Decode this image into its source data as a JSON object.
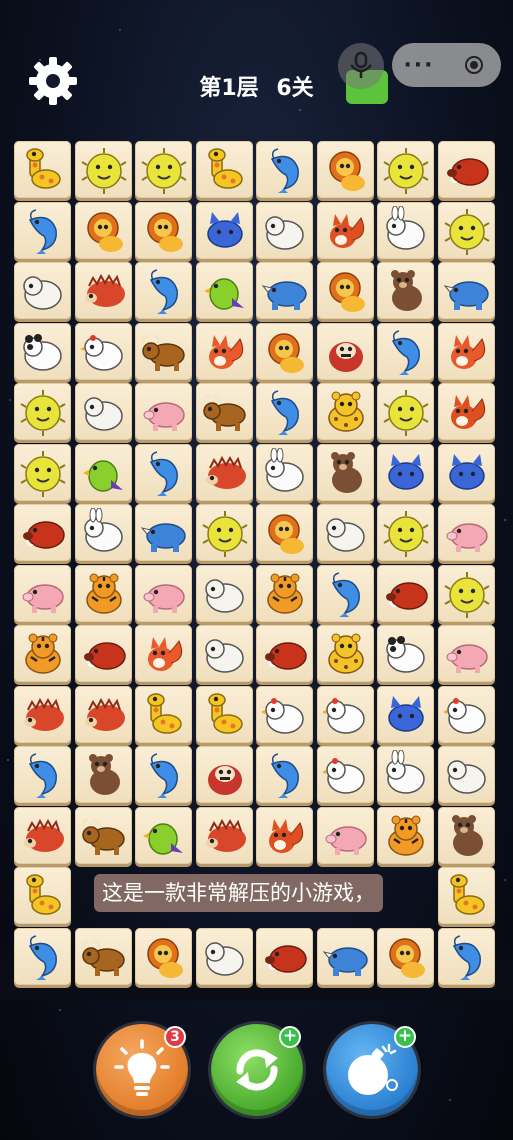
{
  "header": {
    "level": "第1层",
    "stage": "6关"
  },
  "capsule": {
    "more": "···"
  },
  "subtitle": "这是一款非常解压的小游戏，",
  "powerups": {
    "hint_count": "3",
    "shuffle_badge": "+",
    "bomb_badge": "+"
  },
  "board": {
    "rows": 14,
    "cols": 8,
    "tiles": [
      [
        "giraffe",
        "pufferfish",
        "pufferfish",
        "giraffe",
        "shrimp",
        "lion",
        "pufferfish",
        "boar"
      ],
      [
        "shrimp",
        "lion",
        "lion",
        "cat",
        "sheep",
        "squirrel",
        "rabbit",
        "pufferfish"
      ],
      [
        "sheep",
        "hedgehog",
        "shrimp",
        "parrot",
        "rhino",
        "lion",
        "bear",
        "rhino"
      ],
      [
        "panda",
        "chicken",
        "bull",
        "fox",
        "lion",
        "gorilla",
        "shrimp",
        "fox"
      ],
      [
        "pufferfish",
        "sheep",
        "pig",
        "bull",
        "shrimp",
        "leopard",
        "pufferfish",
        "squirrel"
      ],
      [
        "pufferfish",
        "parrot",
        "shrimp",
        "hedgehog",
        "rabbit",
        "bear",
        "cat",
        "cat"
      ],
      [
        "boar",
        "rabbit",
        "rhino",
        "pufferfish",
        "lion",
        "sheep",
        "pufferfish",
        "pig"
      ],
      [
        "pig",
        "tiger",
        "pig",
        "sheep",
        "tiger",
        "shrimp",
        "boar",
        "pufferfish"
      ],
      [
        "tiger",
        "boar",
        "fox",
        "sheep",
        "boar",
        "leopard",
        "panda",
        "pig"
      ],
      [
        "hedgehog",
        "hedgehog",
        "giraffe",
        "giraffe",
        "chicken",
        "chicken",
        "cat",
        "chicken"
      ],
      [
        "shrimp",
        "bear",
        "shrimp",
        "gorilla",
        "shrimp",
        "chicken",
        "rabbit",
        "sheep"
      ],
      [
        "hedgehog",
        "bull",
        "parrot",
        "hedgehog",
        "squirrel",
        "pig",
        "tiger",
        "bear"
      ],
      [
        "giraffe",
        "",
        "",
        "",
        "",
        "",
        "",
        "giraffe"
      ],
      [
        "shrimp",
        "bull",
        "lion",
        "sheep",
        "boar",
        "rhino",
        "lion",
        "shrimp"
      ]
    ]
  },
  "icon_colors": {
    "giraffe": "#f5c623",
    "pufferfish": "#e9e43a",
    "shrimp": "#3f8ee6",
    "lion": "#e0711c",
    "boar": "#c8331b",
    "cat": "#3a66d8",
    "sheep": "#f6f4ee",
    "squirrel": "#de4f22",
    "rabbit": "#fbfbfb",
    "hedgehog": "#d9472a",
    "parrot": "#8ad02d",
    "rhino": "#3d83d8",
    "bear": "#7a4f33",
    "panda": "#fdfdfd",
    "chicken": "#fdfdfd",
    "bull": "#a8651f",
    "fox": "#e85a2b",
    "gorilla": "#c7352b",
    "pig": "#f3a8b4",
    "leopard": "#f3c32a",
    "tiger": "#f19a26"
  }
}
